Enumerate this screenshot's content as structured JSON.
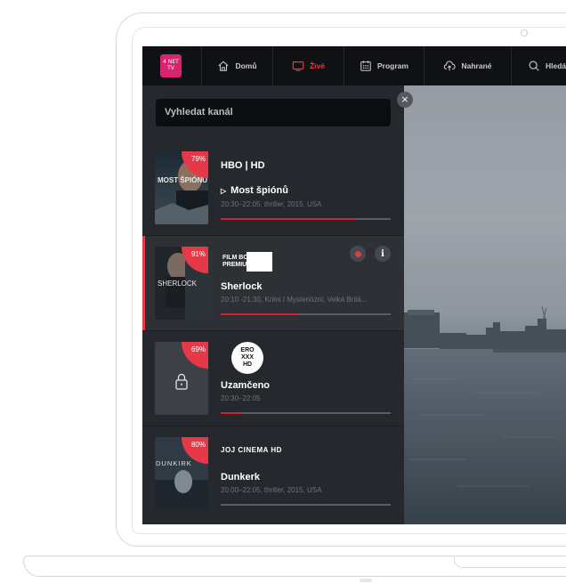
{
  "nav": {
    "items": [
      {
        "label": "Domů",
        "icon": "home-icon",
        "active": false
      },
      {
        "label": "Živé",
        "icon": "tv-icon",
        "active": true
      },
      {
        "label": "Program",
        "icon": "calendar-icon",
        "active": false
      },
      {
        "label": "Nahrané",
        "icon": "cloud-icon",
        "active": false
      },
      {
        "label": "Hledá",
        "icon": "search-icon",
        "active": false
      }
    ],
    "logo_text": "4 NET TV"
  },
  "search": {
    "placeholder": "Vyhledat kanál"
  },
  "channels": [
    {
      "channel": "HBO | HD",
      "percent": "79%",
      "title": "Most špiónů",
      "meta": "20:30–22:05, thriller, 2015, USA",
      "progress": 0.79,
      "poster_text": "MOST ŠPIÓNŮ",
      "playing": true
    },
    {
      "channel": "FILM BOX PREMIUM",
      "percent": "91%",
      "title": "Sherlock",
      "meta": "20:10 -21:30, Krimi / Mysteriózní, Velká Britá...",
      "progress": 0.46,
      "poster_text": "SHERLOCK",
      "highlight": true
    },
    {
      "channel": "ERO XXX HD",
      "percent": "69%",
      "title": "Uzamčeno",
      "meta": "20:30–22:05",
      "progress": 0.12,
      "locked": true
    },
    {
      "channel": "JOJ CINEMA HD",
      "percent": "80%",
      "title": "Dunkerk",
      "meta": "20:00–22:05, thriller, 2015, USA",
      "progress": 0.0,
      "poster_text": "DUNKIRK"
    }
  ],
  "colors": {
    "accent": "#e53947",
    "progress": "#d11f3a",
    "sidebar": "#25282d",
    "nav": "#101114"
  }
}
